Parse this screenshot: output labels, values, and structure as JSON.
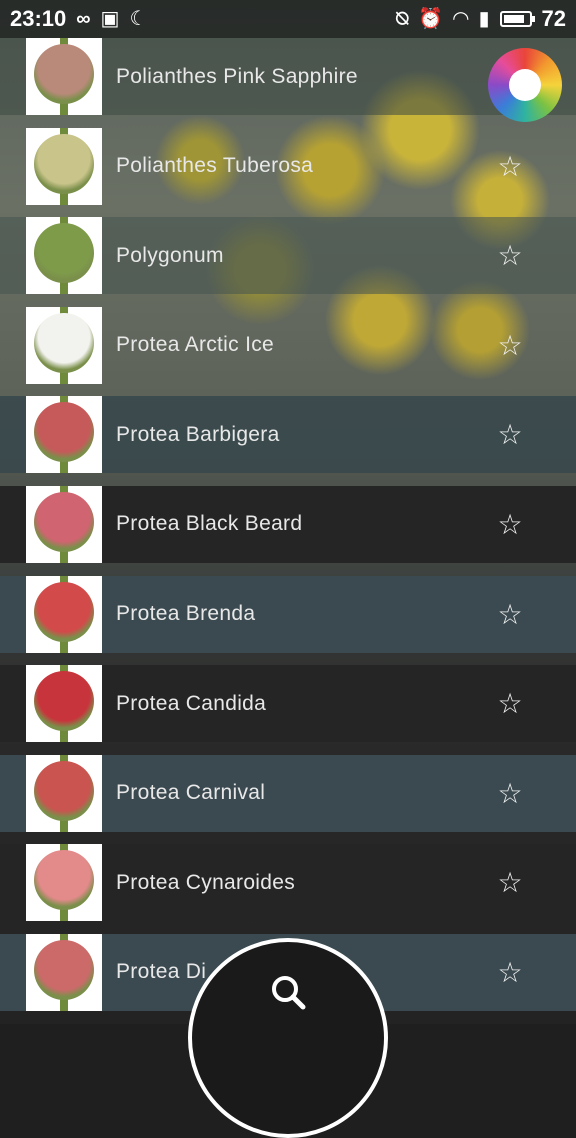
{
  "status_bar": {
    "time": "23:10",
    "left_icons": [
      "infinity-icon",
      "image-icon",
      "moon-icon"
    ],
    "right_icons": [
      "mute-icon",
      "alarm-icon",
      "wifi-icon",
      "signal-icon",
      "battery-icon"
    ],
    "battery": "72"
  },
  "list": {
    "items": [
      {
        "name": "Polianthes Pink Sapphire",
        "starred": false,
        "thumb_color": "#b98a7a",
        "band": "rgba(60,72,66,0.55)"
      },
      {
        "name": "Polianthes Tuberosa",
        "starred": false,
        "thumb_color": "#c9c48a",
        "band": "rgba(0,0,0,0.0)"
      },
      {
        "name": "Polygonum",
        "starred": false,
        "thumb_color": "#7e9b4a",
        "band": "rgba(70,84,80,0.55)"
      },
      {
        "name": "Protea Arctic Ice",
        "starred": false,
        "thumb_color": "#f2f2ee",
        "band": "rgba(0,0,0,0.0)"
      },
      {
        "name": "Protea Barbigera",
        "starred": false,
        "thumb_color": "#c65a5a",
        "band": "rgba(57,72,77,0.9)"
      },
      {
        "name": "Protea Black Beard",
        "starred": false,
        "thumb_color": "#d06470",
        "band": "#252525"
      },
      {
        "name": "Protea Brenda",
        "starred": false,
        "thumb_color": "#d24a4a",
        "band": "#3a4a50"
      },
      {
        "name": "Protea Candida",
        "starred": false,
        "thumb_color": "#c8343c",
        "band": "#252525"
      },
      {
        "name": "Protea Carnival",
        "starred": false,
        "thumb_color": "#c95450",
        "band": "#3a4a50"
      },
      {
        "name": "Protea Cynaroides",
        "starred": false,
        "thumb_color": "#e38a8a",
        "band": "#252525"
      },
      {
        "name": "Protea Di",
        "starred": false,
        "thumb_color": "#cc6a6a",
        "band": "#3a4a50"
      }
    ],
    "star_glyph": "☆"
  },
  "logo": {
    "icon": "app-logo-icon"
  },
  "fab": {
    "icon": "search-icon"
  }
}
